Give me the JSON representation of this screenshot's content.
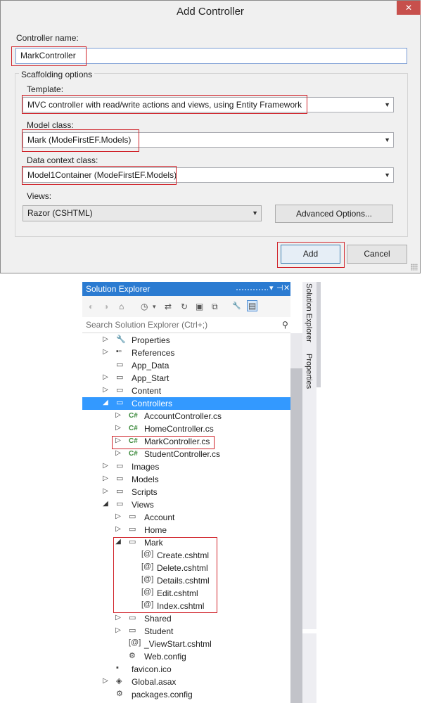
{
  "dialog": {
    "title": "Add Controller",
    "close_glyph": "✕",
    "controller_name_label": "Controller name:",
    "controller_name_value": "MarkController",
    "scaffolding_label": "Scaffolding options",
    "template_label": "Template:",
    "template_value": "MVC controller with read/write actions and views, using Entity Framework",
    "model_class_label": "Model class:",
    "model_class_value": "Mark (ModeFirstEF.Models)",
    "data_context_label": "Data context class:",
    "data_context_value": "Model1Container (ModeFirstEF.Models)",
    "views_label": "Views:",
    "views_value": "Razor (CSHTML)",
    "advanced_button": "Advanced Options...",
    "add_button": "Add",
    "cancel_button": "Cancel"
  },
  "solution_explorer": {
    "title": "Solution Explorer",
    "pin_glyph": "▾",
    "dock_glyph": "⊣",
    "close_glyph": "✕",
    "search_placeholder": "Search Solution Explorer (Ctrl+;)",
    "search_icon_glyph": "⚲",
    "search_dropdown_glyph": "▾",
    "toolbar_icons": [
      {
        "icon": "back-icon",
        "glyph": "◐"
      },
      {
        "icon": "forward-icon",
        "glyph": "◑"
      },
      {
        "icon": "home-icon",
        "glyph": "⌂"
      },
      {
        "icon": "pending-changes-icon",
        "glyph": "◷"
      },
      {
        "icon": "dropdown-icon",
        "glyph": "▾"
      },
      {
        "icon": "sync-icon",
        "glyph": "⇄"
      },
      {
        "icon": "refresh-icon",
        "glyph": "↻"
      },
      {
        "icon": "collapse-all-icon",
        "glyph": "▣"
      },
      {
        "icon": "copy-icon",
        "glyph": "⧉"
      },
      {
        "icon": "properties-icon",
        "glyph": "🔧"
      },
      {
        "icon": "preview-icon",
        "glyph": "▤"
      }
    ],
    "tree": [
      {
        "name": "Properties",
        "arrow": "▷",
        "icon": "wrench-icon",
        "glyph": "🔧",
        "level": 1
      },
      {
        "name": "References",
        "arrow": "▷",
        "icon": "references-icon",
        "glyph": "▪▫",
        "level": 1
      },
      {
        "name": "App_Data",
        "arrow": "",
        "icon": "folder-icon",
        "glyph": "▭",
        "level": 1
      },
      {
        "name": "App_Start",
        "arrow": "▷",
        "icon": "folder-icon",
        "glyph": "▭",
        "level": 1
      },
      {
        "name": "Content",
        "arrow": "▷",
        "icon": "folder-icon",
        "glyph": "▭",
        "level": 1
      },
      {
        "name": "Controllers",
        "arrow": "◢",
        "icon": "folder-open-icon",
        "glyph": "▭",
        "level": 1,
        "selected": true
      },
      {
        "name": "AccountController.cs",
        "arrow": "▷",
        "icon": "csharp-file-icon",
        "glyph": "C#",
        "level": 2
      },
      {
        "name": "HomeController.cs",
        "arrow": "▷",
        "icon": "csharp-file-icon",
        "glyph": "C#",
        "level": 2
      },
      {
        "name": "MarkController.cs",
        "arrow": "▷",
        "icon": "csharp-file-icon",
        "glyph": "C#",
        "level": 2
      },
      {
        "name": "StudentController.cs",
        "arrow": "▷",
        "icon": "csharp-file-icon",
        "glyph": "C#",
        "level": 2
      },
      {
        "name": "Images",
        "arrow": "▷",
        "icon": "folder-icon",
        "glyph": "▭",
        "level": 1
      },
      {
        "name": "Models",
        "arrow": "▷",
        "icon": "folder-icon",
        "glyph": "▭",
        "level": 1
      },
      {
        "name": "Scripts",
        "arrow": "▷",
        "icon": "folder-icon",
        "glyph": "▭",
        "level": 1
      },
      {
        "name": "Views",
        "arrow": "◢",
        "icon": "folder-open-icon",
        "glyph": "▭",
        "level": 1
      },
      {
        "name": "Account",
        "arrow": "▷",
        "icon": "folder-icon",
        "glyph": "▭",
        "level": 2
      },
      {
        "name": "Home",
        "arrow": "▷",
        "icon": "folder-icon",
        "glyph": "▭",
        "level": 2
      },
      {
        "name": "Mark",
        "arrow": "◢",
        "icon": "folder-open-icon",
        "glyph": "▭",
        "level": 2
      },
      {
        "name": "Create.cshtml",
        "arrow": "",
        "icon": "razor-file-icon",
        "glyph": "[@]",
        "level": 3
      },
      {
        "name": "Delete.cshtml",
        "arrow": "",
        "icon": "razor-file-icon",
        "glyph": "[@]",
        "level": 3
      },
      {
        "name": "Details.cshtml",
        "arrow": "",
        "icon": "razor-file-icon",
        "glyph": "[@]",
        "level": 3
      },
      {
        "name": "Edit.cshtml",
        "arrow": "",
        "icon": "razor-file-icon",
        "glyph": "[@]",
        "level": 3
      },
      {
        "name": "Index.cshtml",
        "arrow": "",
        "icon": "razor-file-icon",
        "glyph": "[@]",
        "level": 3
      },
      {
        "name": "Shared",
        "arrow": "▷",
        "icon": "folder-icon",
        "glyph": "▭",
        "level": 2
      },
      {
        "name": "Student",
        "arrow": "▷",
        "icon": "folder-icon",
        "glyph": "▭",
        "level": 2
      },
      {
        "name": "_ViewStart.cshtml",
        "arrow": "",
        "icon": "razor-file-icon",
        "glyph": "[@]",
        "level": 2
      },
      {
        "name": "Web.config",
        "arrow": "",
        "icon": "config-file-icon",
        "glyph": "⚙",
        "level": 2
      },
      {
        "name": "favicon.ico",
        "arrow": "",
        "icon": "ico-file-icon",
        "glyph": "▪",
        "level": 1
      },
      {
        "name": "Global.asax",
        "arrow": "▷",
        "icon": "global-asax-icon",
        "glyph": "◈",
        "level": 1
      },
      {
        "name": "packages.config",
        "arrow": "",
        "icon": "config-file-icon",
        "glyph": "⚙",
        "level": 1
      }
    ]
  },
  "side_tabs": [
    "Solution Explorer",
    "Properties"
  ]
}
